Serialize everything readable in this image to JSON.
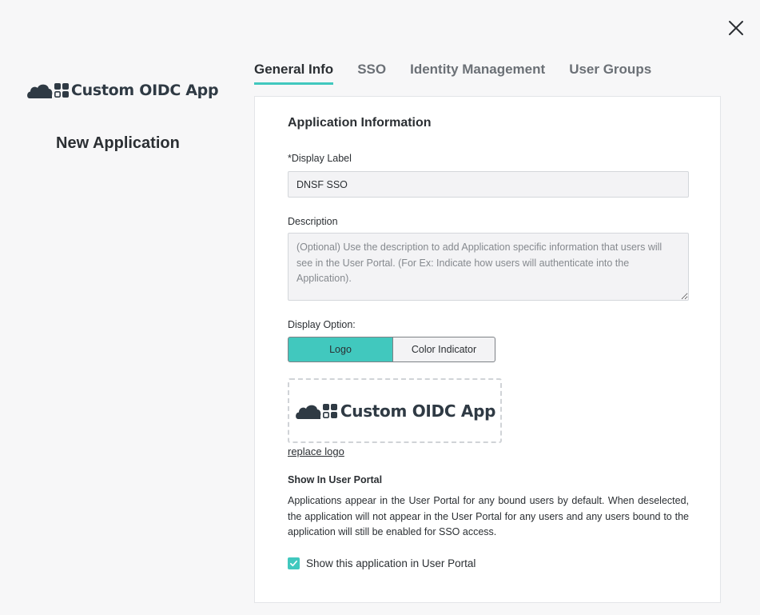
{
  "app": {
    "brand_name": "Custom OIDC App",
    "page_title": "New Application",
    "close_icon": "close-icon"
  },
  "tabs": [
    {
      "label": "General Info",
      "active": true
    },
    {
      "label": "SSO",
      "active": false
    },
    {
      "label": "Identity Management",
      "active": false
    },
    {
      "label": "User Groups",
      "active": false
    }
  ],
  "form": {
    "section_title": "Application Information",
    "display_label": {
      "label": "*Display Label",
      "value": "DNSF SSO"
    },
    "description": {
      "label": "Description",
      "placeholder": "(Optional) Use the description to add Application specific information that users will see in the User Portal. (For Ex: Indicate how users will authenticate into the Application).",
      "value": ""
    },
    "display_option": {
      "label": "Display Option:",
      "options": [
        "Logo",
        "Color Indicator"
      ],
      "selected": "Logo"
    },
    "logo_preview": {
      "brand_name": "Custom OIDC App",
      "replace_label": "replace logo"
    },
    "user_portal": {
      "title": "Show In User Portal",
      "description": "Applications appear in the User Portal for any bound users by default. When deselected, the application will not appear in the User Portal for any users and any users bound to the application will still be enabled for SSO access.",
      "checkbox_label": "Show this application in User Portal",
      "checked": true
    }
  },
  "colors": {
    "accent": "#41c8be",
    "text": "#2b2f33",
    "background": "#f7f7f8",
    "brand_dark": "#2f3a44"
  }
}
